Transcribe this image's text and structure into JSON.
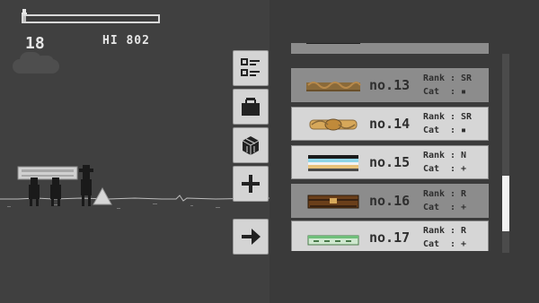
{
  "hud": {
    "score": "18",
    "hi_label": "HI 802",
    "progress_fraction": 0.02
  },
  "side_buttons": [
    {
      "name": "checklist-icon"
    },
    {
      "name": "shop-bag-icon"
    },
    {
      "name": "box-icon"
    },
    {
      "name": "plus-icon"
    },
    {
      "name": "arrow-right-icon"
    }
  ],
  "coffins": [
    {
      "num": "",
      "rank_label": "",
      "rank": "",
      "cat_label": "",
      "cat": "",
      "locked": true,
      "style": "dark"
    },
    {
      "num": "no.13",
      "rank_label": "Rank",
      "rank": "SR",
      "cat_label": "Cat",
      "cat": "▪",
      "locked": true,
      "style": "rope"
    },
    {
      "num": "no.14",
      "rank_label": "Rank",
      "rank": "SR",
      "cat_label": "Cat",
      "cat": "▪",
      "locked": false,
      "style": "ornate"
    },
    {
      "num": "no.15",
      "rank_label": "Rank",
      "rank": "N",
      "cat_label": "Cat",
      "cat": "+",
      "locked": false,
      "style": "striped"
    },
    {
      "num": "no.16",
      "rank_label": "Rank",
      "rank": "R",
      "cat_label": "Cat",
      "cat": "+",
      "locked": true,
      "style": "wood"
    },
    {
      "num": "no.17",
      "rank_label": "Rank",
      "rank": "R",
      "cat_label": "Cat",
      "cat": "+",
      "locked": false,
      "style": "green"
    }
  ],
  "colors": {
    "game_bg": "#404040",
    "panel_bg": "#3a3a3a",
    "item_bg": "#d6d6d6",
    "item_locked_bg": "#8c8c8c",
    "text": "#2f2f2f"
  }
}
